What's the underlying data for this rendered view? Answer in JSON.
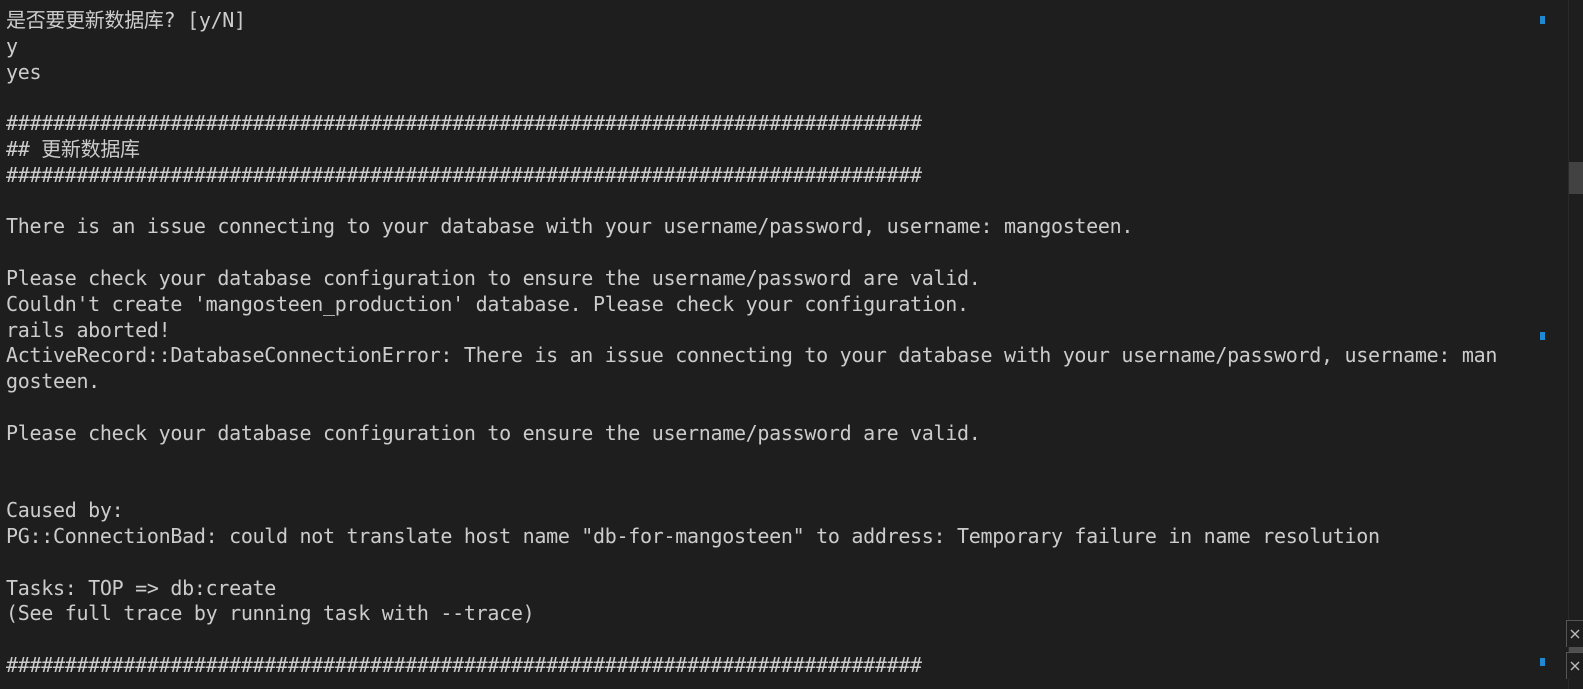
{
  "terminal": {
    "lines": [
      "是否要更新数据库? [y/N]",
      "y",
      "yes",
      "",
      "##############################################################################",
      "## 更新数据库",
      "##############################################################################",
      "",
      "There is an issue connecting to your database with your username/password, username: mangosteen.",
      "",
      "Please check your database configuration to ensure the username/password are valid.",
      "Couldn't create 'mangosteen_production' database. Please check your configuration.",
      "rails aborted!",
      "ActiveRecord::DatabaseConnectionError: There is an issue connecting to your database with your username/password, username: man",
      "gosteen.",
      "",
      "Please check your database configuration to ensure the username/password are valid.",
      "",
      "",
      "Caused by:",
      "PG::ConnectionBad: could not translate host name \"db-for-mangosteen\" to address: Temporary failure in name resolution",
      "",
      "Tasks: TOP => db:create",
      "(See full trace by running task with --trace)",
      "",
      "##############################################################################"
    ]
  },
  "colors": {
    "background": "#1e1e1e",
    "foreground": "#cccccc",
    "marker": "#1f8ad2"
  },
  "icons": {
    "corner_top": "close-icon",
    "corner_bottom": "close-icon"
  }
}
